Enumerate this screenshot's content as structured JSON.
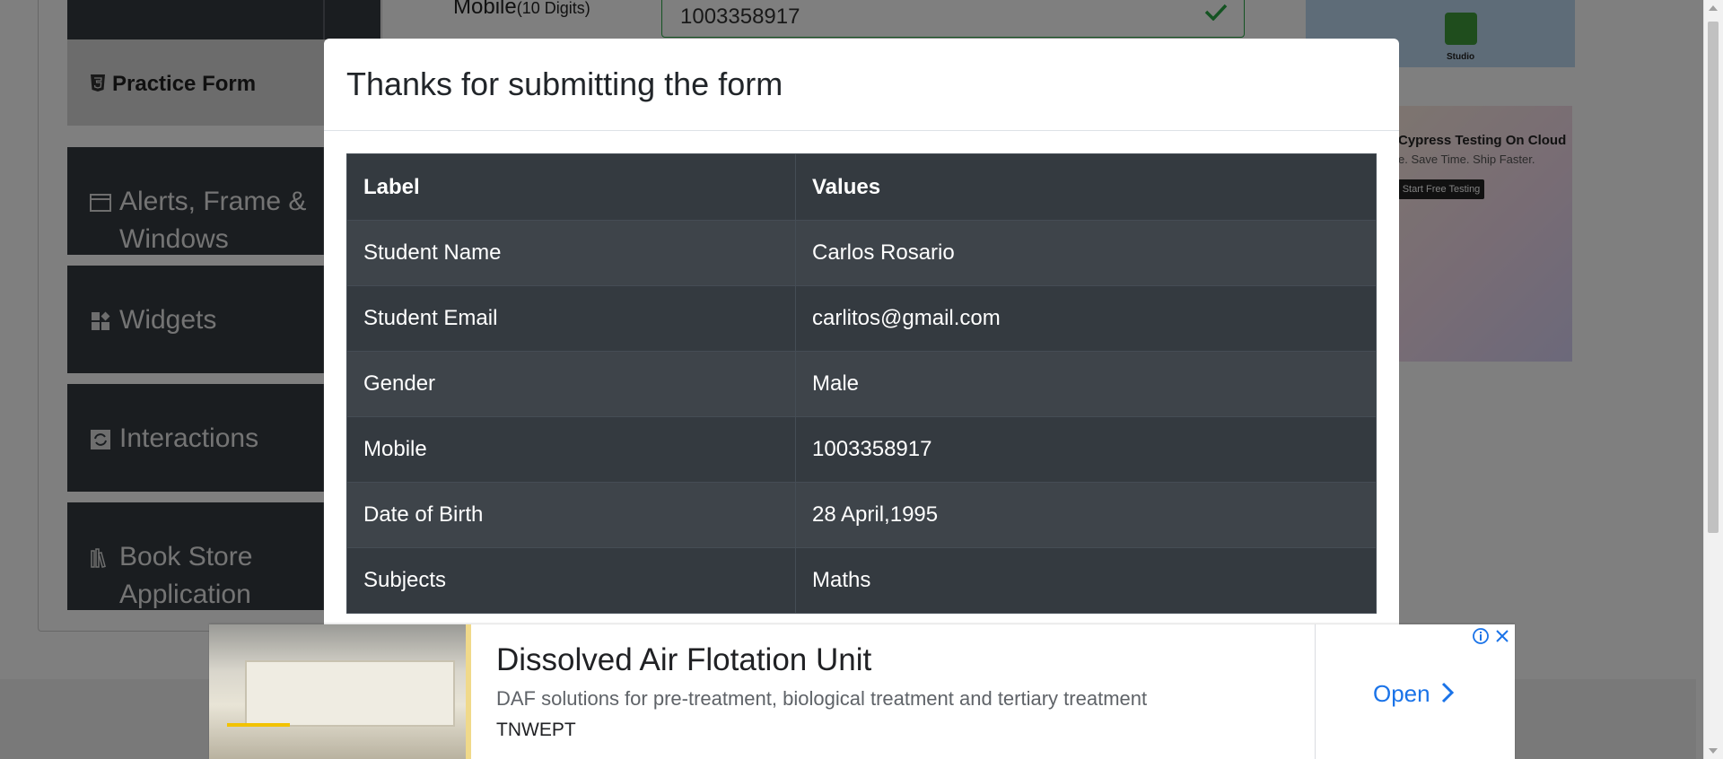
{
  "background": {
    "sidebar": {
      "practice_form_label": "Practice Form",
      "items": [
        {
          "label": "Alerts, Frame &",
          "label2": "Windows"
        },
        {
          "label": "Widgets"
        },
        {
          "label": "Interactions"
        },
        {
          "label": "Book Store",
          "label2": "Application"
        }
      ]
    },
    "form": {
      "mobile_label": "Mobile",
      "mobile_hint": "(10 Digits)",
      "mobile_value": "1003358917"
    },
    "side_ads": {
      "studio_label": "Studio",
      "cypress_title": "Cypress Testing On Cloud",
      "cypress_subtitle": "e. Save Time. Ship Faster.",
      "cypress_button": "Start Free Testing"
    }
  },
  "modal": {
    "title": "Thanks for submitting the form",
    "table": {
      "headers": [
        "Label",
        "Values"
      ],
      "rows": [
        {
          "label": "Student Name",
          "value": "Carlos Rosario"
        },
        {
          "label": "Student Email",
          "value": "carlitos@gmail.com"
        },
        {
          "label": "Gender",
          "value": "Male"
        },
        {
          "label": "Mobile",
          "value": "1003358917"
        },
        {
          "label": "Date of Birth",
          "value": "28 April,1995"
        },
        {
          "label": "Subjects",
          "value": "Maths"
        }
      ]
    }
  },
  "bottom_ad": {
    "title": "Dissolved Air Flotation Unit",
    "description": "DAF solutions for pre-treatment, biological treatment and tertiary treatment",
    "source": "TNWEPT",
    "cta": "Open"
  },
  "colors": {
    "table_dark": "#343a40",
    "table_stripe": "#3e444a",
    "accent_blue": "#1a73e8",
    "valid_green": "#28a745"
  }
}
